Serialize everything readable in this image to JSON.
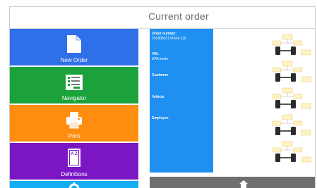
{
  "header": {
    "title": "Current order"
  },
  "menu": {
    "new_order": "New Order",
    "navigator": "Navigator",
    "print": "Print",
    "definitions": "Definitions",
    "definitions_icon_text": "A Z"
  },
  "order": {
    "number_label": "Order number:",
    "number_value": "20180802174104-120",
    "vin_label": "VIN:",
    "vin_value": "EPA trailer",
    "customer_label": "Customer",
    "vehicle_label": "Vehicle",
    "employee_label": "Employee"
  },
  "colors": {
    "new_order": "#2f6fe8",
    "navigator": "#1ca23b",
    "print": "#ff8d10",
    "definitions": "#7b16c4",
    "settings": "#16aef2",
    "details_panel": "#1f8ff2",
    "bottom_bar": "#6f6f6f"
  },
  "icons": [
    "document-icon",
    "navigator-grid-icon",
    "printer-icon",
    "az-book-icon",
    "gear-icon",
    "home-icon"
  ]
}
